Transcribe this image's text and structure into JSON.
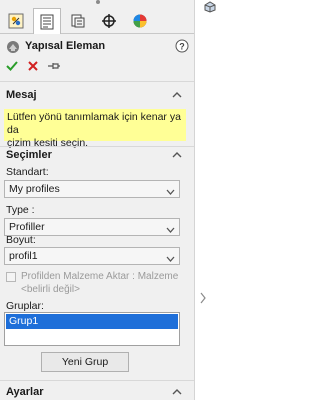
{
  "tabs": [
    {
      "icon": "featuremanager-icon",
      "active": false
    },
    {
      "icon": "propertymanager-icon",
      "active": true
    },
    {
      "icon": "configurationmanager-icon",
      "active": false
    },
    {
      "icon": "dimxpertmanager-icon",
      "active": false
    },
    {
      "icon": "displaymanager-icon",
      "active": false
    }
  ],
  "panel": {
    "title": "Yapısal Eleman",
    "title_icon": "structural-member-icon",
    "help_icon": "help-icon",
    "actions": {
      "ok": "check-icon",
      "cancel": "close-icon",
      "pin": "pushpin-icon"
    }
  },
  "message": {
    "header": "Mesaj",
    "text_line1": "Lütfen yönü tanımlamak için kenar ya da",
    "text_line2": "çizim kesiti seçin."
  },
  "selections": {
    "header": "Seçimler",
    "standard_label": "Standart:",
    "standard_value": "My profiles",
    "type_label": "Type :",
    "type_value": "Profiller",
    "size_label": "Boyut:",
    "size_value": "profil1",
    "transfer_label_line1": "Profilden Malzeme Aktar : Malzeme",
    "transfer_label_line2": "<belirli değil>",
    "groups_label": "Gruplar:",
    "groups": [
      "Grup1"
    ],
    "new_group_button": "Yeni Grup"
  },
  "settings": {
    "header": "Ayarlar"
  },
  "colors": {
    "panel_bg": "#f0f0f0",
    "message_bg": "#ffff96",
    "selection_blue": "#1e6fd9",
    "ok_green": "#2a9d2a",
    "cancel_red": "#d22020"
  }
}
